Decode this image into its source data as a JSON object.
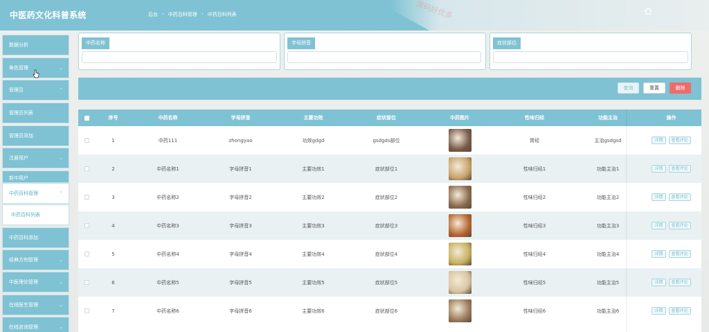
{
  "app": {
    "title": "中医药文化科普系统"
  },
  "breadcrumb": [
    "后台",
    "中药百科管理",
    "中药百科列表"
  ],
  "watermark": "源码好优多",
  "sidebar": {
    "items": [
      {
        "label": "数据分析",
        "chev": ""
      },
      {
        "label": "角色管理",
        "chev": "⌄"
      },
      {
        "label": "管理员",
        "chev": "⌃"
      },
      {
        "label": "管理员列表",
        "chev": ""
      },
      {
        "label": "管理员添加",
        "chev": ""
      },
      {
        "label": "注册用户",
        "chev": "⌄"
      },
      {
        "label": "新中用户",
        "chev": ""
      },
      {
        "label": "中药百科管理",
        "chev": "⌃"
      },
      {
        "label": "中药百科列表",
        "chev": ""
      },
      {
        "label": "中药百科添加",
        "chev": ""
      },
      {
        "label": "经典方剂管理",
        "chev": "⌄"
      },
      {
        "label": "中医理论管理",
        "chev": "⌄"
      },
      {
        "label": "在线医生管理",
        "chev": "⌄"
      },
      {
        "label": "在线咨询管理",
        "chev": "⌄"
      }
    ]
  },
  "search": {
    "name_label": "中药名称",
    "pinyin_label": "字母拼音",
    "symptom_label": "症状部位",
    "name_value": "",
    "pinyin_value": "",
    "symptom_value": ""
  },
  "toolbar": {
    "search_label": "查询",
    "reset_label": "重置",
    "delete_label": "删除"
  },
  "table": {
    "headers": [
      "序号",
      "中药名称",
      "字母拼音",
      "主要功效",
      "症状部位",
      "中药图片",
      "性味归经",
      "功能主治",
      "操作"
    ],
    "detail_label": "详情",
    "review_label": "查看评论",
    "rows": [
      {
        "no": "1",
        "name": "中药111",
        "pinyin": "zhongyao",
        "effect": "功效gdgd",
        "part": "gsdgds部位",
        "meridian": "胃经",
        "indication": "主治gsdgsd",
        "img": "#7a5a4a"
      },
      {
        "no": "2",
        "name": "中药名称1",
        "pinyin": "字母拼音1",
        "effect": "主要功效1",
        "part": "症状部位1",
        "meridian": "性味归经1",
        "indication": "功能主治1",
        "img": "#c9a46a"
      },
      {
        "no": "3",
        "name": "中药名称2",
        "pinyin": "字母拼音2",
        "effect": "主要功效2",
        "part": "症状部位2",
        "meridian": "性味归经2",
        "indication": "功能主治2",
        "img": "#8a6a4e"
      },
      {
        "no": "4",
        "name": "中药名称3",
        "pinyin": "字母拼音3",
        "effect": "主要功效3",
        "part": "症状部位3",
        "meridian": "性味归经3",
        "indication": "功能主治3",
        "img": "#b7652e"
      },
      {
        "no": "5",
        "name": "中药名称4",
        "pinyin": "字母拼音4",
        "effect": "主要功效4",
        "part": "症状部位4",
        "meridian": "性味归经4",
        "indication": "功能主治4",
        "img": "#c8b060"
      },
      {
        "no": "6",
        "name": "中药名称5",
        "pinyin": "字母拼音5",
        "effect": "主要功效5",
        "part": "症状部位5",
        "meridian": "性味归经5",
        "indication": "功能主治5",
        "img": "#d8c4a0"
      },
      {
        "no": "7",
        "name": "中药名称6",
        "pinyin": "字母拼音6",
        "effect": "主要功效6",
        "part": "症状部位6",
        "meridian": "性味归经6",
        "indication": "功能主治6",
        "img": "#9b7b5b"
      }
    ]
  },
  "colors": {
    "accent": "#7fc2d3",
    "danger": "#f06a6a",
    "row_alt": "#e9f1f3"
  }
}
